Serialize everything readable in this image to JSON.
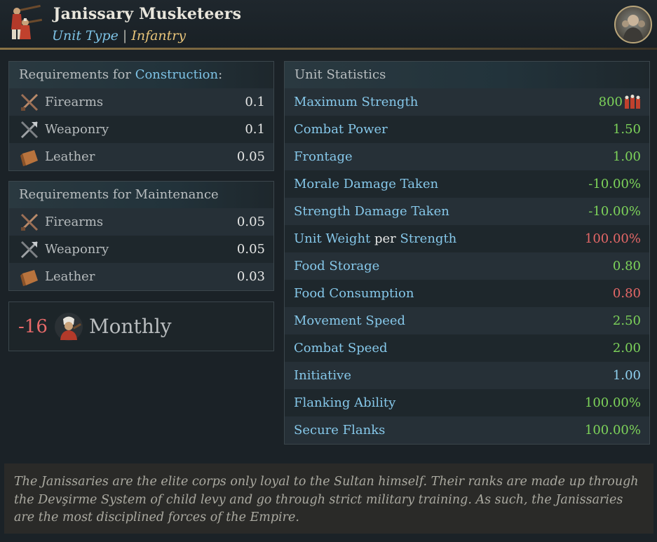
{
  "header": {
    "title": "Janissary Musketeers",
    "subtitle_key": "Unit Type",
    "subtitle_sep": "|",
    "subtitle_value": "Infantry"
  },
  "construction": {
    "heading_prefix": "Requirements for",
    "heading_highlight": "Construction",
    "heading_suffix": ":",
    "items": [
      {
        "icon": "firearms-icon",
        "label": "Firearms",
        "value": "0.1"
      },
      {
        "icon": "weaponry-icon",
        "label": "Weaponry",
        "value": "0.1"
      },
      {
        "icon": "leather-icon",
        "label": "Leather",
        "value": "0.05"
      }
    ]
  },
  "maintenance": {
    "heading": "Requirements for Maintenance",
    "items": [
      {
        "icon": "firearms-icon",
        "label": "Firearms",
        "value": "0.05"
      },
      {
        "icon": "weaponry-icon",
        "label": "Weaponry",
        "value": "0.05"
      },
      {
        "icon": "leather-icon",
        "label": "Leather",
        "value": "0.03"
      }
    ]
  },
  "cost": {
    "value": "-16",
    "icon": "soldier-icon",
    "label": "Monthly"
  },
  "stats": {
    "heading": "Unit Statistics",
    "rows": [
      {
        "label": "Maximum Strength",
        "value": "800",
        "icon": "regiment-icon",
        "color": "#7dd35a"
      },
      {
        "label": "Combat Power",
        "value": "1.50",
        "color": "#7dd35a"
      },
      {
        "label": "Frontage",
        "value": "1.00",
        "color": "#7dd35a"
      },
      {
        "label": "Morale Damage Taken",
        "value": "-10.00%",
        "color": "#7dd35a"
      },
      {
        "label": "Strength Damage Taken",
        "value": "-10.00%",
        "color": "#7dd35a"
      },
      {
        "label_a": "Unit Weight",
        "label_b": "per",
        "label_c": "Strength",
        "value": "100.00%",
        "color": "#e46767"
      },
      {
        "label": "Food Storage",
        "value": "0.80",
        "color": "#7dd35a"
      },
      {
        "label": "Food Consumption",
        "value": "0.80",
        "color": "#e46767"
      },
      {
        "label": "Movement Speed",
        "value": "2.50",
        "color": "#7dd35a"
      },
      {
        "label": "Combat Speed",
        "value": "2.00",
        "color": "#7dd35a"
      },
      {
        "label": "Initiative",
        "value": "1.00",
        "color": "#8fd0ef"
      },
      {
        "label": "Flanking Ability",
        "value": "100.00%",
        "color": "#7dd35a"
      },
      {
        "label": "Secure Flanks",
        "value": "100.00%",
        "color": "#7dd35a"
      }
    ]
  },
  "description": "The Janissaries are the elite corps only loyal to the Sultan himself. Their ranks are made up through the Devşirme System of child levy and go through strict military training. As such, the Janissaries are the most disciplined forces of the Empire."
}
